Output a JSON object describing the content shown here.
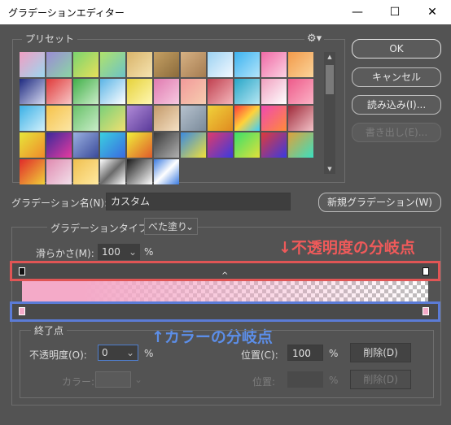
{
  "title": "グラデーションエディター",
  "window_controls": {
    "minimize": "—",
    "maximize": "☐",
    "close": "✕"
  },
  "presets": {
    "label": "プリセット",
    "swatches": [
      "linear-gradient(135deg,#f19ec2,#9bd7f0)",
      "linear-gradient(135deg,#9b8bd6,#8bd6a3)",
      "linear-gradient(135deg,#7ad46f,#e8e05a)",
      "linear-gradient(135deg,#b0e26b,#6cc3c8)",
      "linear-gradient(135deg,#d9b46a,#f5e3b0)",
      "linear-gradient(135deg,#c5a063,#8b6b3c)",
      "linear-gradient(135deg,#d6b183,#a57c51)",
      "linear-gradient(135deg,#9cd2f2,#f2f8ff)",
      "linear-gradient(135deg,#3cb3f0,#b3e4fa)",
      "linear-gradient(135deg,#f06aa6,#fbd2e2)",
      "linear-gradient(135deg,#f29a4a,#fbd49a)",
      "linear-gradient(135deg,#1e2a80,#d6d9f0)",
      "linear-gradient(135deg,#e03a3a,#f7c7c7)",
      "linear-gradient(135deg,#42b04a,#c9ecc7)",
      "linear-gradient(135deg,#5ab4e6,#ffffff)",
      "linear-gradient(135deg,#e6d23a,#fff7b3)",
      "linear-gradient(135deg,#e07ab0,#f6c9e0)",
      "linear-gradient(135deg,#f29a9a,#f6cdb0)",
      "linear-gradient(135deg,#c04050,#f4b6bb)",
      "linear-gradient(135deg,#28a6c8,#b6e6f2)",
      "linear-gradient(135deg,#f0a0c0,#ffffff)",
      "linear-gradient(135deg,#ee5a8a,#fbb3c6)",
      "linear-gradient(135deg,#3ab0e6,#d2f0fb)",
      "linear-gradient(135deg,#f6c24a,#fbe6a6)",
      "linear-gradient(135deg,#6ac26a,#c8ecc8)",
      "linear-gradient(135deg,#7ad07a,#f0e070)",
      "linear-gradient(135deg,#b08ad6,#5a3a9a)",
      "linear-gradient(135deg,#c49a6a,#f4e0c4)",
      "linear-gradient(135deg,#b6c2ce,#7a8a9a)",
      "linear-gradient(135deg,#f0d23a,#e08a20)",
      "linear-gradient(135deg,#ff3a3a,#ffd23a,#3ad0ff)",
      "linear-gradient(135deg,#f04ab0,#ff8a3a)",
      "linear-gradient(135deg,#a02a3a,#f2c2c8)",
      "linear-gradient(135deg,#e6e63a,#f08a2a)",
      "linear-gradient(135deg,#3a2a9a,#e63aa0)",
      "linear-gradient(135deg,#9ab0e0,#3a4a9a)",
      "linear-gradient(135deg,#3ad0e0,#3a6ae0)",
      "linear-gradient(135deg,#f0f03a,#e05a2a)",
      "linear-gradient(135deg,#3a3a3a,#b0b0b0)",
      "linear-gradient(135deg,#3a8ae0,#f0e03a)",
      "linear-gradient(135deg,#e03a6a,#3a3ae0)",
      "linear-gradient(135deg,#3ae06a,#e0e03a)",
      "linear-gradient(135deg,#e03a3a,#3a3ae0)",
      "linear-gradient(135deg,#e0a03a,#3ae0c0)",
      "linear-gradient(135deg,#e02a2a,#f0d03a)",
      "linear-gradient(135deg,#e08ab0,#f2e0ea)",
      "linear-gradient(135deg,#f0c050,#ffe9a0)",
      "linear-gradient(135deg,#ffffff,#6a6a6a,#ffffff)",
      "linear-gradient(135deg,#1a1a1a,#ffffff)",
      "linear-gradient(135deg,#3a7ae0,#ffffff,#3a7ae0)"
    ],
    "scroll_up": "▲",
    "scroll_down": "▼"
  },
  "buttons": {
    "ok": "OK",
    "cancel": "キャンセル",
    "load": "読み込み(I)...",
    "save": "書き出し(E)...",
    "new_gradient": "新規グラデーション(W)"
  },
  "name": {
    "label": "グラデーション名(N):",
    "value": "カスタム"
  },
  "type": {
    "label": "グラデーションタイプ:",
    "value": "べた塗り"
  },
  "smoothness": {
    "label": "滑らかさ(M):",
    "value": "100",
    "unit": "%"
  },
  "annotations": {
    "opacity_stops": "↓不透明度の分岐点",
    "color_stops": "↑カラーの分岐点"
  },
  "stops": {
    "section_label": "終了点",
    "opacity_label": "不透明度(O):",
    "opacity_value": "0",
    "opacity_unit": "%",
    "position_label": "位置(C):",
    "position_value": "100",
    "position_unit": "%",
    "delete_label": "削除(D)",
    "color_label": "カラー:",
    "color_position_label": "位置:",
    "color_position_unit": "%",
    "color_delete_label": "削除(D)"
  },
  "colors": {
    "bg": "#535353",
    "gradient_start": "#f4aac8",
    "annot_red": "#e05555",
    "annot_blue": "#5b7bd6"
  }
}
